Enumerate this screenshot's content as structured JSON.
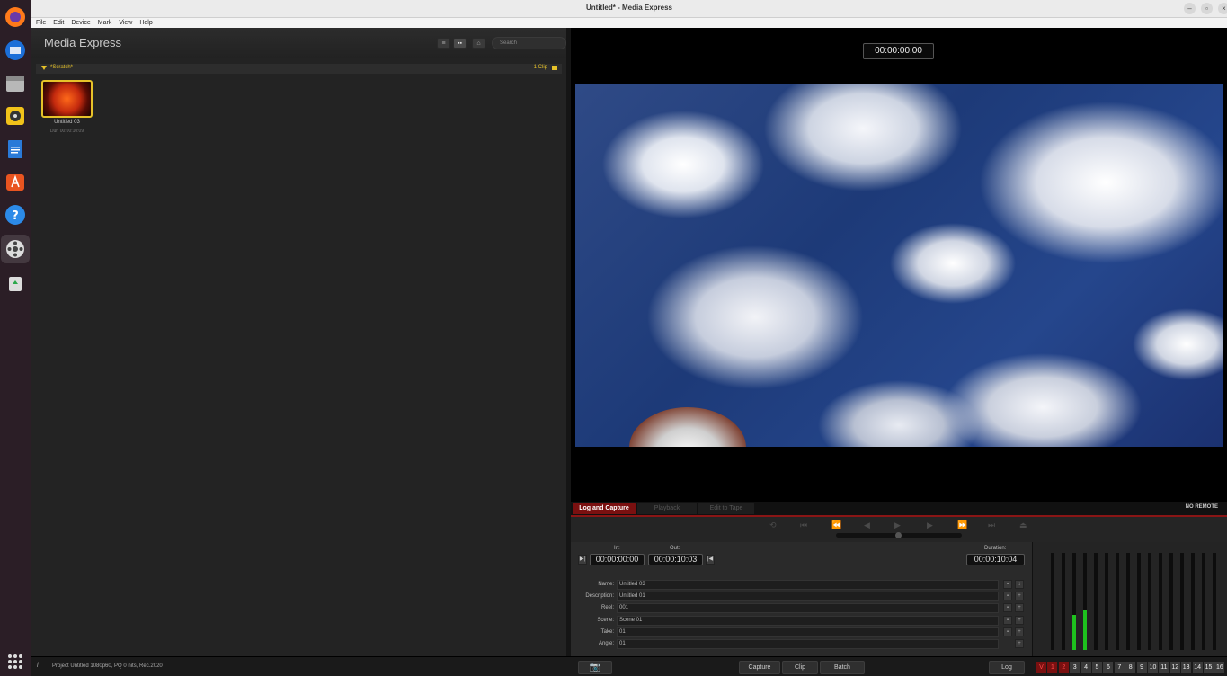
{
  "window": {
    "title": "Untitled* - Media Express"
  },
  "menu": [
    "File",
    "Edit",
    "Device",
    "Mark",
    "View",
    "Help"
  ],
  "dock": [
    "firefox-icon",
    "thunderbird-icon",
    "files-icon",
    "rhythmbox-icon",
    "writer-icon",
    "app-center-icon",
    "help-icon",
    "media-express-icon",
    "trash-icon"
  ],
  "library": {
    "app_name": "Media Express",
    "search_placeholder": "Search",
    "bin": {
      "name": "*Scratch*",
      "count": "1 Clip"
    },
    "clips": [
      {
        "name": "Untitled 03",
        "duration": "Dur: 00:00:10:09"
      }
    ]
  },
  "viewer": {
    "timecode": "00:00:00:00"
  },
  "tabs": {
    "log": "Log and Capture",
    "playback": "Playback",
    "edit": "Edit to Tape",
    "remote": "NO REMOTE"
  },
  "log": {
    "in_label": "In:",
    "in_value": "00:00:00:00",
    "out_label": "Out:",
    "out_value": "00:00:10:03",
    "duration_label": "Duration:",
    "duration_value": "00:00:10:04",
    "fields": [
      {
        "label": "Name:",
        "value": "Untitled 03"
      },
      {
        "label": "Description:",
        "value": "Untitled 01"
      },
      {
        "label": "Reel:",
        "value": "001"
      },
      {
        "label": "Scene:",
        "value": "Scene 01"
      },
      {
        "label": "Take:",
        "value": "01"
      },
      {
        "label": "Angle:",
        "value": "01"
      }
    ]
  },
  "audio": {
    "levels": [
      0,
      0,
      0.36,
      0.41,
      0,
      0,
      0,
      0,
      0,
      0,
      0,
      0,
      0,
      0,
      0,
      0
    ],
    "meter_color": "#1ec21e"
  },
  "status": {
    "text": "Project Untitled  1080p60, PQ 0 nits, Rec.2020",
    "capture": "Capture",
    "clip": "Clip",
    "batch": "Batch",
    "log": "Log",
    "channels": [
      "V",
      "1",
      "2",
      "3",
      "4",
      "5",
      "6",
      "7",
      "8",
      "9",
      "10",
      "11",
      "12",
      "13",
      "14",
      "15",
      "16"
    ]
  },
  "colors": {
    "accent": "#e6c229",
    "record_red": "#7a1010"
  }
}
